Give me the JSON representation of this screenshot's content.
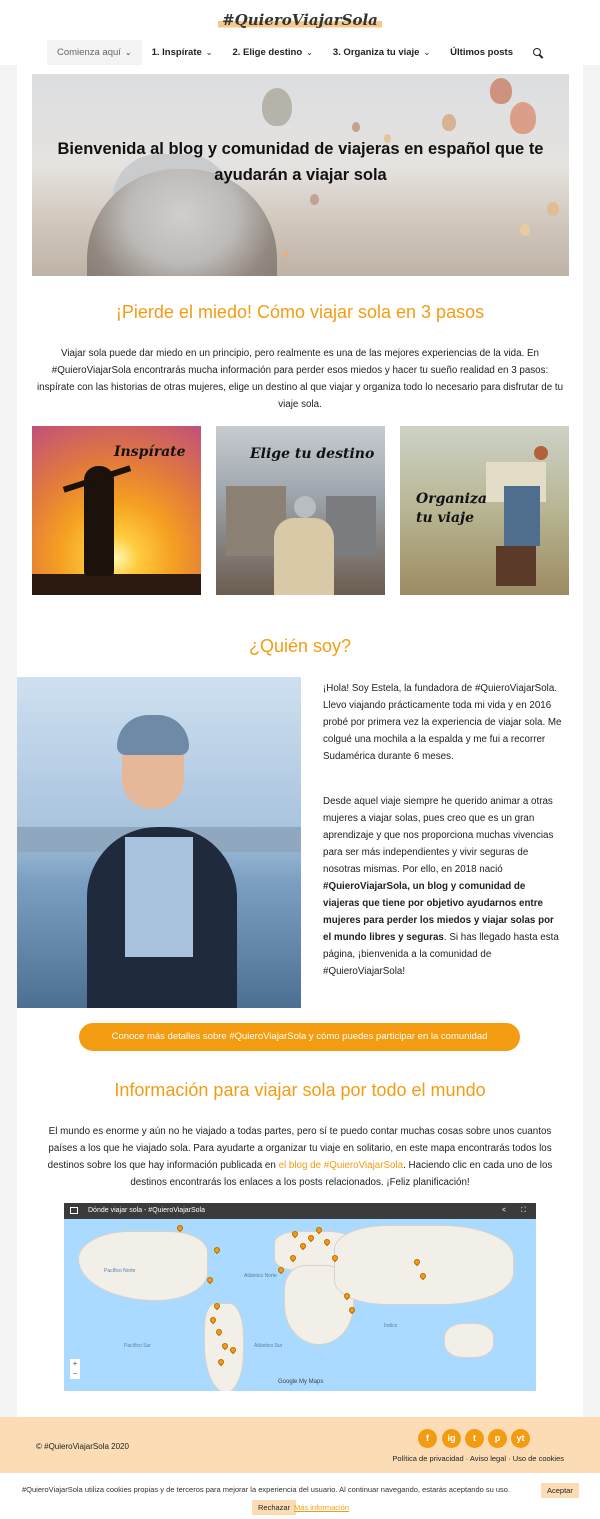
{
  "header": {
    "logo": "#QuieroViajarSola",
    "nav": [
      {
        "label": "Comienza aquí",
        "chevron": true
      },
      {
        "label": "1. Inspírate",
        "chevron": true
      },
      {
        "label": "2. Elige destino",
        "chevron": true
      },
      {
        "label": "3. Organiza tu viaje",
        "chevron": true
      },
      {
        "label": "Últimos posts",
        "chevron": false
      }
    ],
    "search_icon": "search-icon"
  },
  "hero": {
    "title": "Bienvenida al blog y comunidad de viajeras en español que te ayudarán a viajar sola"
  },
  "steps": {
    "heading": "¡Pierde el miedo! Cómo viajar sola en 3 pasos",
    "intro": "Viajar sola puede dar miedo en un principio, pero realmente es una de las mejores experiencias de la vida. En #QuieroViajarSola encontrarás mucha información para perder esos miedos y hacer tu sueño realidad en 3 pasos: inspírate con las historias de otras mujeres, elige un destino al que viajar y organiza todo lo necesario para disfrutar de tu viaje sola.",
    "tiles": [
      {
        "label": "Inspírate"
      },
      {
        "label": "Elige tu destino"
      },
      {
        "label": "Organiza tu viaje"
      }
    ]
  },
  "about": {
    "heading": "¿Quién soy?",
    "p1": "¡Hola! Soy Estela, la fundadora de #QuieroViajarSola. Llevo viajando prácticamente toda mi vida y en 2016 probé por primera vez la experiencia de viajar sola. Me colgué una mochila a la espalda y me fui a recorrer Sudamérica durante 6 meses.",
    "p2_a": "Desde aquel viaje siempre he querido animar a otras mujeres a viajar solas, pues creo que es un gran aprendizaje y que nos proporciona muchas vivencias para ser más independientes y vivir seguras de nosotras mismas. Por ello, en 2018 nació ",
    "p2_b": "#QuieroViajarSola, un blog y comunidad de viajeras que tiene por objetivo ayudarnos entre mujeres para perder los miedos y viajar solas por el mundo libres y seguras",
    "p2_c": ". Si has llegado hasta esta página, ¡bienvenida a la comunidad de #QuieroViajarSola!",
    "cta": "Conoce más detalles sobre #QuieroViajarSola y cómo puedes participar en la comunidad"
  },
  "world": {
    "heading": "Información para viajar sola por todo el mundo",
    "p_a": "El mundo es enorme y aún no he viajado a todas partes, pero sí te puedo contar muchas cosas sobre unos cuantos países a los que he viajado sola. Para ayudarte a organizar tu viaje en solitario, en este mapa encontrarás todos los destinos sobre los que hay información publicada en ",
    "p_link": "el blog de #QuieroViajarSola",
    "p_b": ". Haciendo clic en cada uno de los destinos encontrarás los enlaces a los posts relacionados. ¡Feliz planificación!",
    "map_title": "Dónde viajar sola - #QuieroViajarSola",
    "map_labels": {
      "pac_norte": "Pacífico Norte",
      "atl_norte": "Atlántico Norte",
      "pac_sur": "Pacífico Sur",
      "atl_sur": "Atlántico Sur",
      "indico": "Índico"
    },
    "map_footer": "Google My Maps"
  },
  "footer": {
    "copyright": "© #QuieroViajarSola 2020",
    "links": [
      "Política de privacidad",
      "Aviso legal",
      "Uso de cookies"
    ],
    "social": [
      "f",
      "ig",
      "t",
      "p",
      "yt"
    ]
  },
  "cookies": {
    "text": "#QuieroViajarSola utiliza cookies propias y de terceros para mejorar la experiencia del usuario. Al continuar navegando, estarás aceptando su uso.",
    "accept": "Aceptar",
    "reject": "Rechazar",
    "more": "Más información"
  }
}
